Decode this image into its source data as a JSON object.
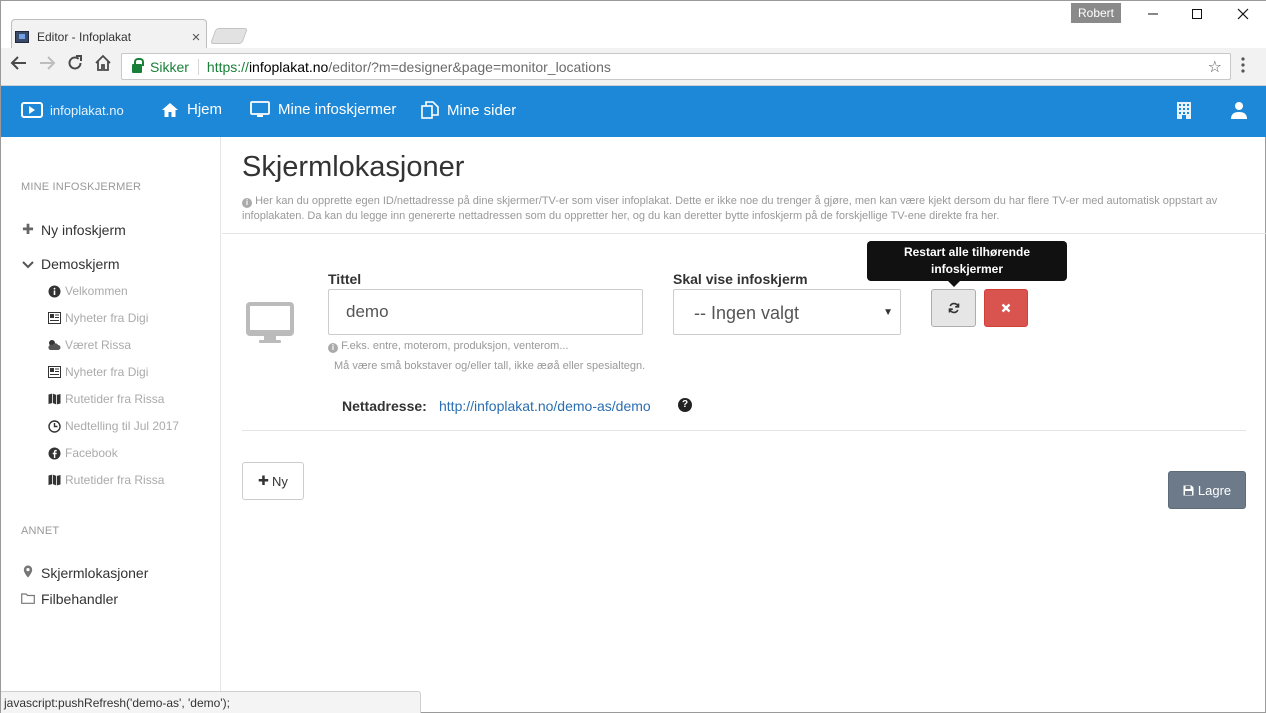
{
  "browser": {
    "tab_title": "Editor - Infoplakat",
    "tab_close": "×",
    "profile": "Robert",
    "secure_label": "Sikker",
    "url_scheme": "https://",
    "url_host": "infoplakat.no",
    "url_path": "/editor/?m=designer&page=monitor_locations",
    "status_url": "javascript:pushRefresh('demo-as', 'demo');"
  },
  "appbar": {
    "brand": "infoplakat.no",
    "nav": [
      "Hjem",
      "Mine infoskjermer",
      "Mine sider"
    ]
  },
  "sidebar": {
    "heading_screens": "MINE INFOSKJERMER",
    "new_screen": "Ny infoskjerm",
    "group": "Demoskjerm",
    "sub_items": [
      "Velkommen",
      "Nyheter fra Digi",
      "Været Rissa",
      "Nyheter fra Digi",
      "Rutetider fra Rissa",
      "Nedtelling til Jul 2017",
      "Facebook",
      "Rutetider fra Rissa"
    ],
    "heading_other": "ANNET",
    "other_items": [
      "Skjermlokasjoner",
      "Filbehandler"
    ]
  },
  "main": {
    "title": "Skjermlokasjoner",
    "description": "Her kan du opprette egen ID/nettadresse på dine skjermer/TV-er som viser infoplakat. Dette er ikke noe du trenger å gjøre, men kan være kjekt dersom du har flere TV-er med automatisk oppstart av infoplakaten. Da kan du legge inn genererte nettadressen som du oppretter her, og du kan deretter bytte infoskjerm på de forskjellige TV-ene direkte fra her.",
    "title_label": "Tittel",
    "title_value": "demo",
    "title_help1": "F.eks. entre, moterom, produksjon, venterom...",
    "title_help2": "Må være små bokstaver og/eller tall, ikke æøå eller spesialtegn.",
    "screen_label": "Skal vise infoskjerm",
    "screen_value": "-- Ingen valgt",
    "tooltip": "Restart alle tilhørende infoskjermer",
    "url_label": "Nettadresse:",
    "url_value": "http://infoplakat.no/demo-as/demo",
    "new_button": "Ny",
    "save_button": "Lagre"
  },
  "colors": {
    "brand_blue": "#1e88d8",
    "danger": "#d9534f",
    "save": "#6c7a89"
  }
}
